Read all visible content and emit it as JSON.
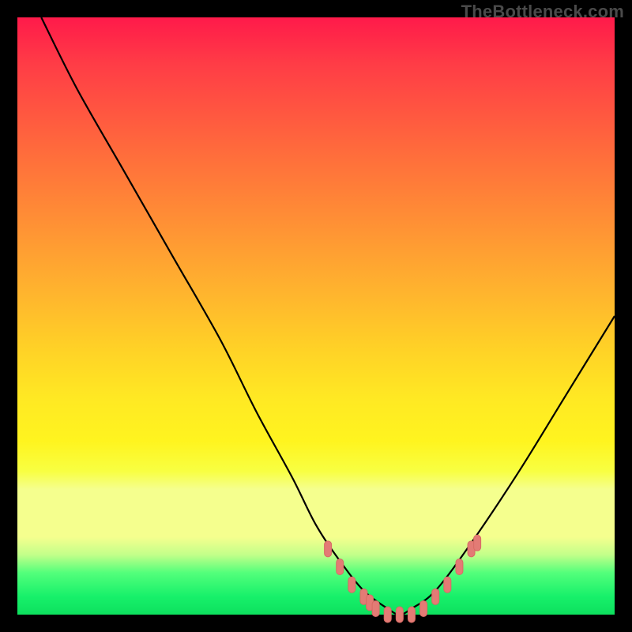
{
  "watermark": "TheBottleneck.com",
  "colors": {
    "frame": "#000000",
    "curve": "#000000",
    "marker_fill": "#e37b75",
    "marker_stroke": "#d86a64",
    "gradient_stops": [
      "#ff1a4a",
      "#ff6a3c",
      "#ffd326",
      "#f5ff8e",
      "#17f06a"
    ]
  },
  "chart_data": {
    "type": "line",
    "title": "",
    "xlabel": "",
    "ylabel": "",
    "xlim": [
      0,
      100
    ],
    "ylim": [
      0,
      100
    ],
    "annotations": [],
    "series": [
      {
        "name": "bottleneck-curve",
        "x": [
          4,
          10,
          18,
          26,
          34,
          40,
          46,
          50,
          54,
          58,
          62,
          64,
          66,
          70,
          76,
          84,
          92,
          100
        ],
        "y": [
          100,
          88,
          74,
          60,
          46,
          34,
          23,
          15,
          9,
          4,
          1,
          0,
          1,
          4,
          12,
          24,
          37,
          50
        ]
      }
    ],
    "markers": {
      "name": "highlighted-near-floor",
      "x": [
        52,
        54,
        56,
        58,
        59,
        60,
        62,
        64,
        66,
        68,
        70,
        72,
        74,
        76,
        77
      ],
      "y": [
        11,
        8,
        5,
        3,
        2,
        1,
        0,
        0,
        0,
        1,
        3,
        5,
        8,
        11,
        12
      ]
    }
  }
}
